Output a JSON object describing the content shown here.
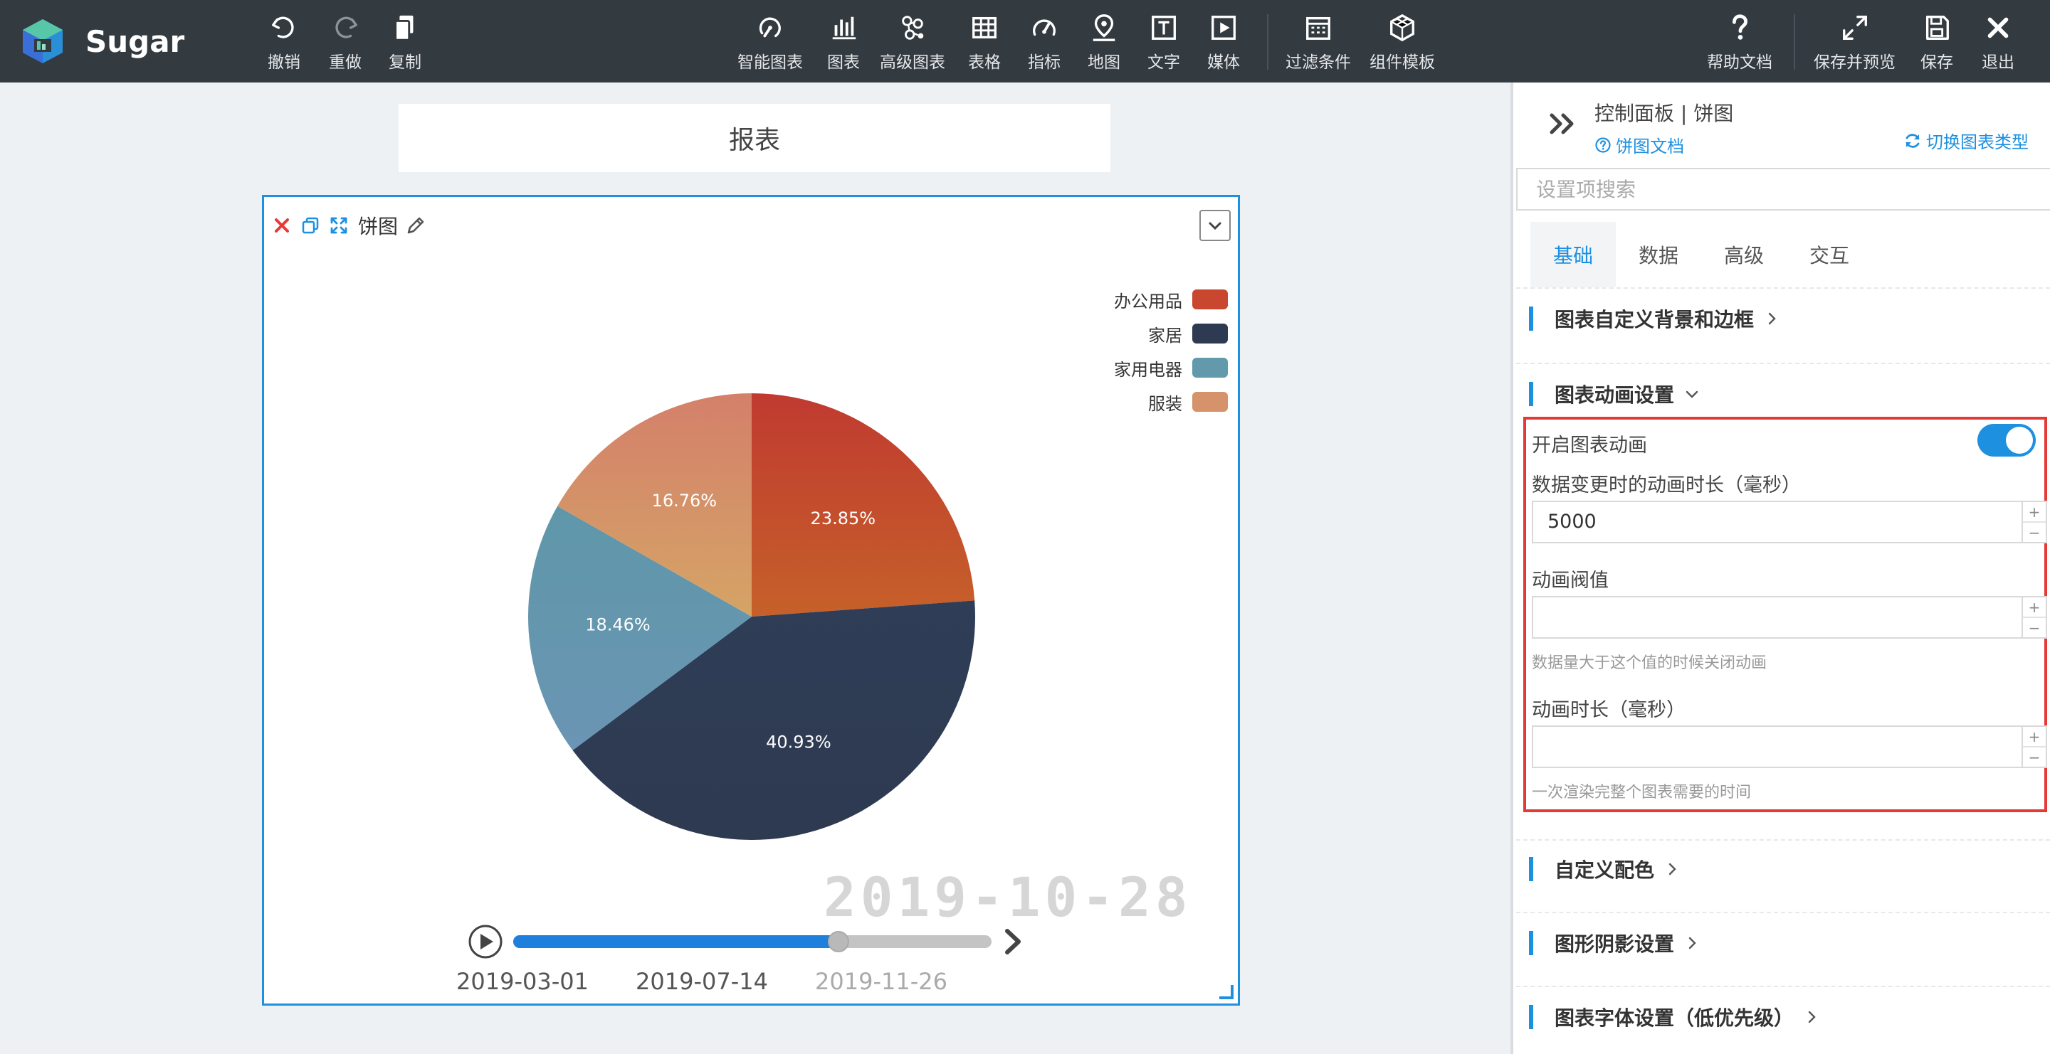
{
  "app": {
    "name": "Sugar"
  },
  "toolbar": {
    "left": [
      {
        "label": "撤销",
        "icon": "undo-icon"
      },
      {
        "label": "重做",
        "icon": "redo-icon"
      },
      {
        "label": "复制",
        "icon": "copy-icon"
      }
    ],
    "center": [
      {
        "label": "智能图表",
        "icon": "smart-chart-icon"
      },
      {
        "label": "图表",
        "icon": "bar-chart-icon"
      },
      {
        "label": "高级图表",
        "icon": "advanced-chart-icon"
      },
      {
        "label": "表格",
        "icon": "table-icon"
      },
      {
        "label": "指标",
        "icon": "gauge-icon"
      },
      {
        "label": "地图",
        "icon": "map-pin-icon"
      },
      {
        "label": "文字",
        "icon": "text-icon"
      },
      {
        "label": "媒体",
        "icon": "media-icon"
      },
      {
        "label": "过滤条件",
        "icon": "filter-calendar-icon"
      },
      {
        "label": "组件模板",
        "icon": "template-icon"
      }
    ],
    "right": [
      {
        "label": "帮助文档",
        "icon": "help-icon"
      },
      {
        "label": "保存并预览",
        "icon": "expand-icon"
      },
      {
        "label": "保存",
        "icon": "save-icon"
      },
      {
        "label": "退出",
        "icon": "close-icon"
      }
    ]
  },
  "canvas": {
    "report_title": "报表",
    "card": {
      "name": "饼图"
    },
    "timeline": {
      "current_date": "2019-10-28",
      "ticks": [
        "2019-03-01",
        "2019-07-14",
        "2019-11-26"
      ],
      "progress": 0.68
    }
  },
  "chart_data": {
    "type": "pie",
    "categories": [
      "办公用品",
      "家居",
      "家用电器",
      "服装"
    ],
    "values": [
      23.85,
      40.93,
      18.46,
      16.76
    ],
    "labels": [
      "23.85%",
      "40.93%",
      "18.46%",
      "16.76%"
    ],
    "colors": [
      "#c0412f",
      "#2e3a52",
      "#6299ab",
      "#d6926a"
    ],
    "legend": "top-right"
  },
  "panel": {
    "title": "控制面板 | 饼图",
    "doc_link": "饼图文档",
    "switch_link": "切换图表类型",
    "search_placeholder": "设置项搜索",
    "tabs": [
      "基础",
      "数据",
      "高级",
      "交互"
    ],
    "active_tab": "基础",
    "sections": {
      "bg_border": "图表自定义背景和边框",
      "animation": "图表动画设置",
      "color": "自定义配色",
      "shadow": "图形阴影设置",
      "font": "图表字体设置（低优先级）"
    },
    "animation": {
      "enable_label": "开启图表动画",
      "enabled": true,
      "update_duration_label": "数据变更时的动画时长（毫秒）",
      "update_duration_value": "5000",
      "threshold_label": "动画阀值",
      "threshold_value": "",
      "threshold_hint": "数据量大于这个值的时候关闭动画",
      "duration_label": "动画时长（毫秒）",
      "duration_value": "",
      "duration_hint": "一次渲染完整个图表需要的时间"
    }
  }
}
